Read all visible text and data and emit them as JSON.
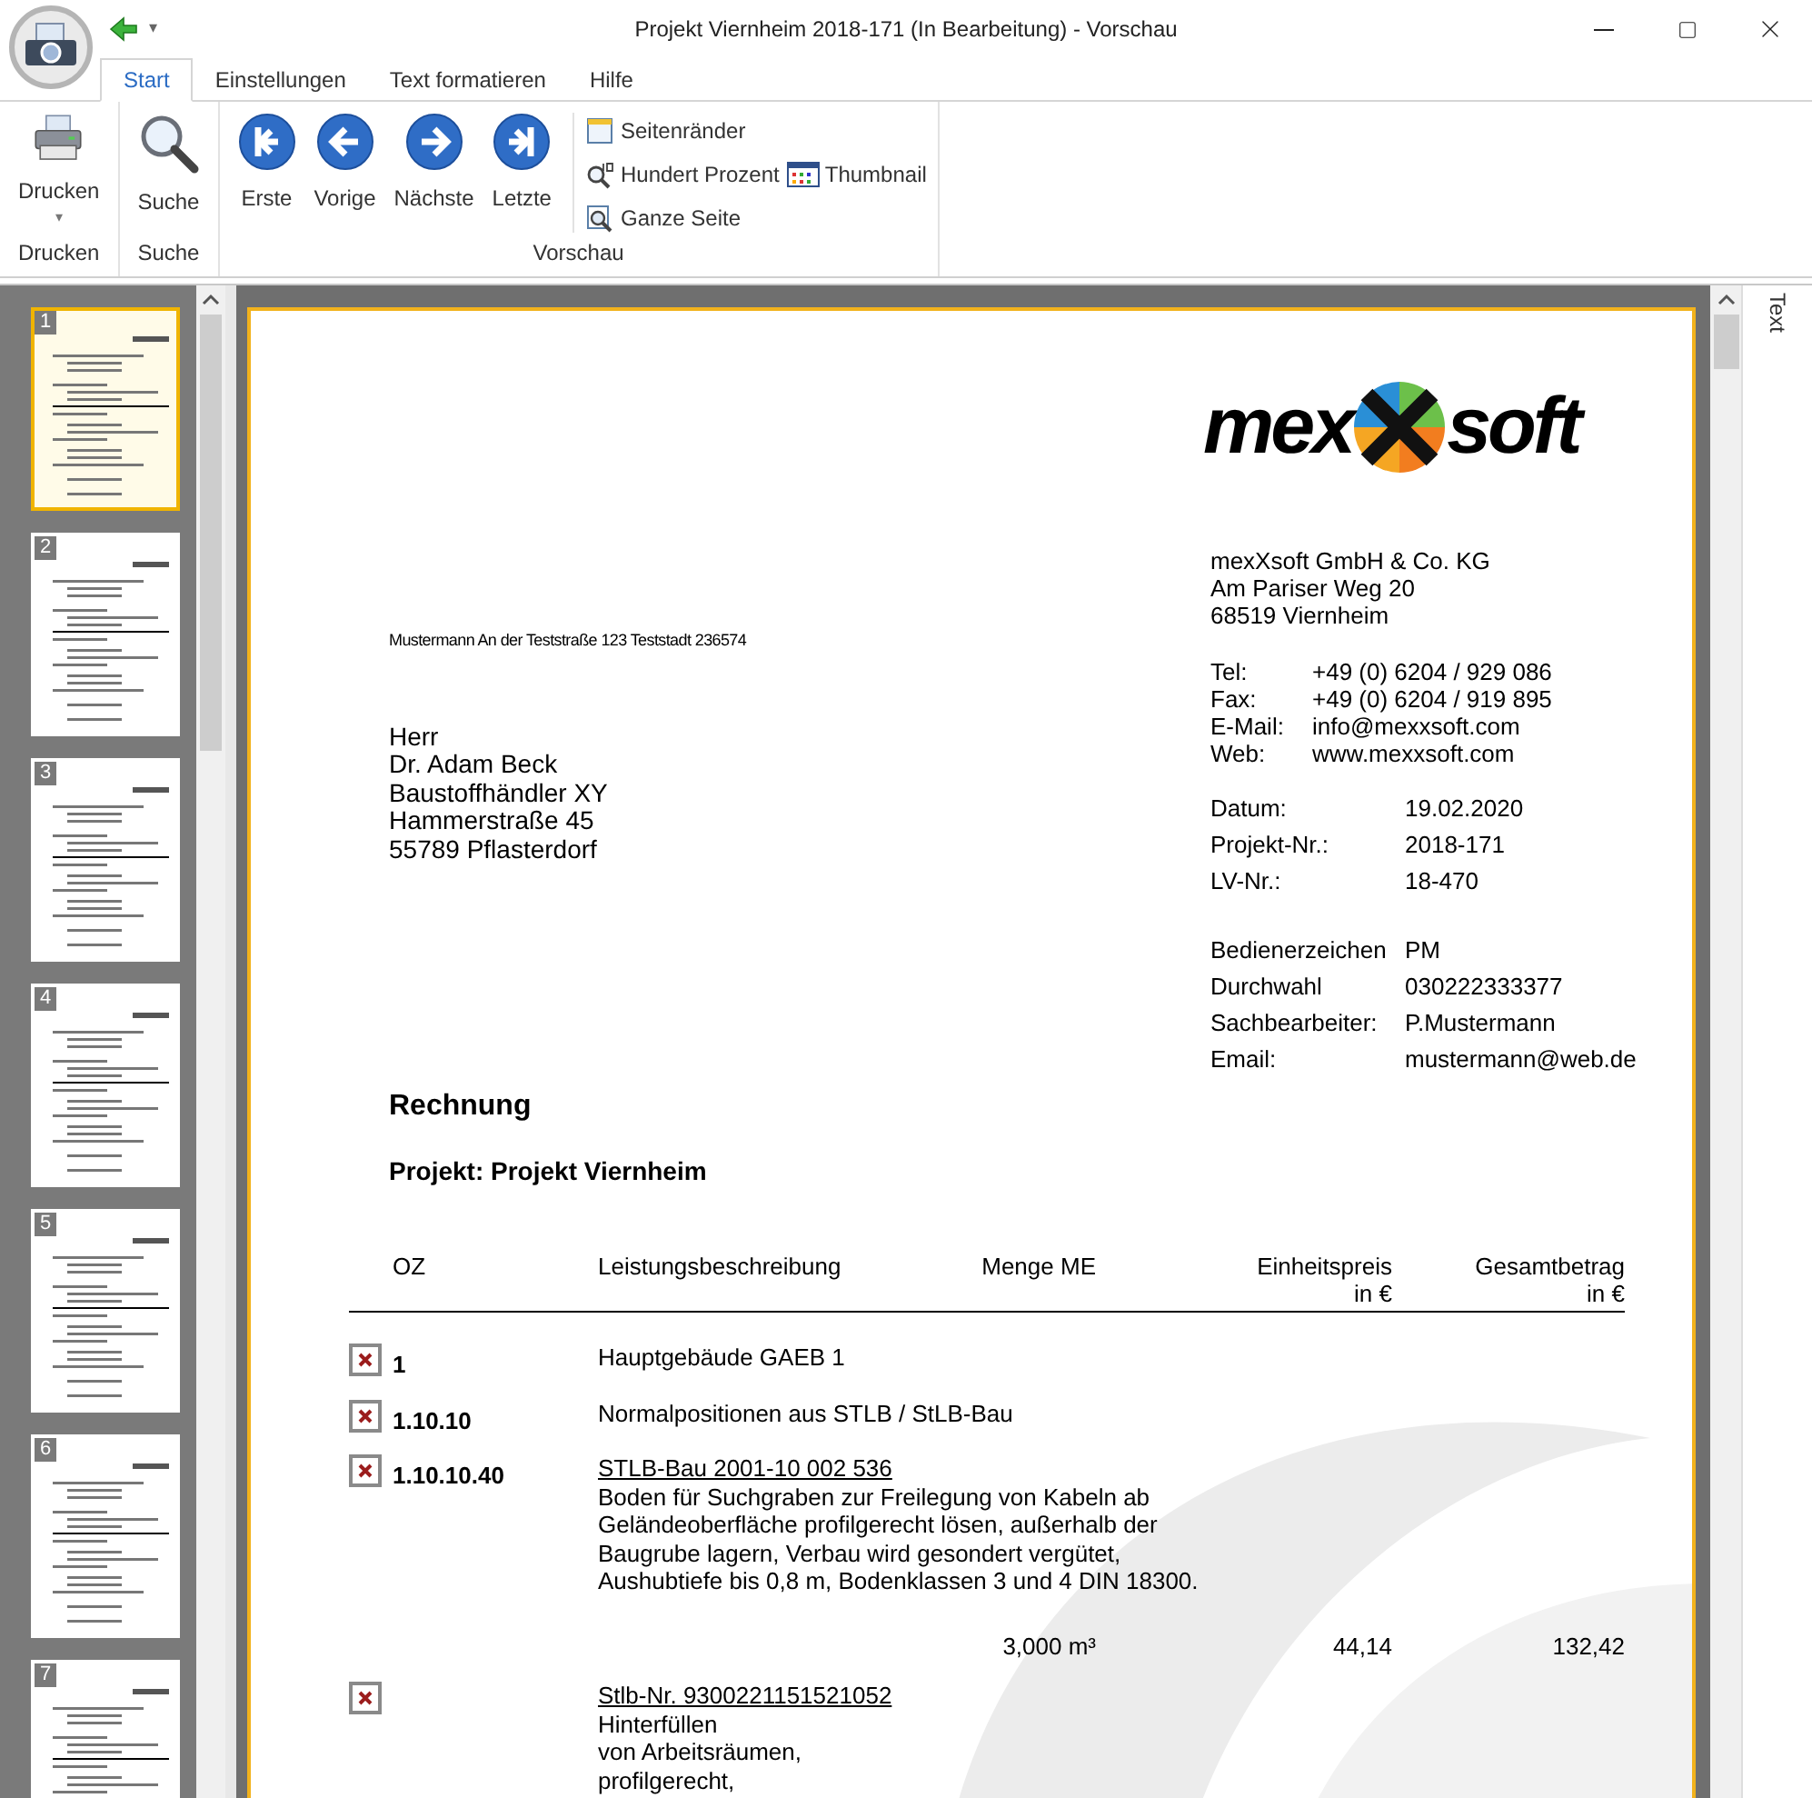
{
  "window": {
    "title": "Projekt Viernheim 2018-171 (In Bearbeitung) - Vorschau",
    "quick_access_caret": "▾"
  },
  "tabs": [
    {
      "label": "Start",
      "selected": true
    },
    {
      "label": "Einstellungen",
      "selected": false
    },
    {
      "label": "Text formatieren",
      "selected": false
    },
    {
      "label": "Hilfe",
      "selected": false
    }
  ],
  "ribbon": {
    "groups": [
      {
        "label": "Drucken",
        "buttons": [
          {
            "kind": "print",
            "label": "Drucken",
            "caret": "▾"
          }
        ]
      },
      {
        "label": "Suche",
        "buttons": [
          {
            "kind": "search",
            "label": "Suche"
          }
        ]
      },
      {
        "label": "Vorschau",
        "buttons": [
          {
            "kind": "first",
            "label": "Erste"
          },
          {
            "kind": "prev",
            "label": "Vorige"
          },
          {
            "kind": "next",
            "label": "Nächste"
          },
          {
            "kind": "last",
            "label": "Letzte"
          }
        ],
        "small_buttons": [
          {
            "kind": "margins",
            "label": "Seitenränder"
          },
          {
            "kind": "zoom100",
            "label": "Hundert Prozent"
          },
          {
            "kind": "thumbnail",
            "label": "Thumbnail"
          },
          {
            "kind": "wholepage",
            "label": "Ganze Seite"
          }
        ]
      }
    ]
  },
  "thumbnails": [
    {
      "label": "1",
      "selected": true
    },
    {
      "label": "2",
      "selected": false
    },
    {
      "label": "3",
      "selected": false
    },
    {
      "label": "4",
      "selected": false
    },
    {
      "label": "5",
      "selected": false
    },
    {
      "label": "6",
      "selected": false
    },
    {
      "label": "7",
      "selected": false
    }
  ],
  "side_panel": {
    "label": "Text"
  },
  "document": {
    "logo": {
      "left": "mex",
      "right": "soft"
    },
    "sender_line": "Mustermann An der Teststraße 123  Teststadt 236574",
    "recipient": [
      "Herr",
      "Dr. Adam Beck",
      "Baustoffhändler XY",
      "Hammerstraße 45",
      "55789 Pflasterdorf"
    ],
    "company": [
      "mexXsoft GmbH & Co. KG",
      "Am Pariser Weg 20",
      "68519 Viernheim"
    ],
    "contact": [
      {
        "label": "Tel:",
        "value": "+49 (0) 6204 / 929 086"
      },
      {
        "label": "Fax:",
        "value": "+49 (0) 6204 / 919 895"
      },
      {
        "label": "E-Mail:",
        "value": "info@mexxsoft.com"
      },
      {
        "label": "Web:",
        "value": "www.mexxsoft.com"
      }
    ],
    "meta": [
      {
        "label": "Datum:",
        "value": "19.02.2020"
      },
      {
        "label": "Projekt-Nr.:",
        "value": "2018-171"
      },
      {
        "label": "LV-Nr.:",
        "value": "18-470"
      }
    ],
    "staff": [
      {
        "label": "Bedienerzeichen",
        "value": "PM"
      },
      {
        "label": "Durchwahl",
        "value": "030222333377"
      },
      {
        "label": "Sachbearbeiter:",
        "value": "P.Mustermann"
      },
      {
        "label": "Email:",
        "value": "mustermann@web.de"
      }
    ],
    "heading": "Rechnung",
    "project": "Projekt: Projekt Viernheim",
    "columns": [
      {
        "lines": [
          "OZ"
        ]
      },
      {
        "lines": [
          "Leistungsbeschreibung"
        ]
      },
      {
        "lines": [
          "Menge ME"
        ]
      },
      {
        "lines": [
          "Einheitspreis",
          "in €"
        ]
      },
      {
        "lines": [
          "Gesamtbetrag",
          "in €"
        ]
      }
    ],
    "rows": [
      {
        "oz": "1",
        "title": "Hauptgebäude GAEB 1",
        "underlined": false
      },
      {
        "oz": "1.10.10",
        "title": "Normalpositionen aus STLB / StLB-Bau",
        "underlined": false
      },
      {
        "oz": "1.10.10.40",
        "title": "STLB-Bau 2001-10 002 536",
        "underlined": true,
        "description": [
          "Boden für Suchgraben zur Freilegung von Kabeln ab",
          "Geländeoberfläche profilgerecht lösen, außerhalb der",
          "Baugrube lagern, Verbau wird gesondert vergütet,",
          "Aushubtiefe bis 0,8 m, Bodenklassen 3 und 4 DIN 18300."
        ],
        "quantity": "3,000 m³",
        "unit_price": "44,14",
        "total": "132,42"
      },
      {
        "title": "Stlb-Nr. 9300221151521052",
        "underlined": true,
        "description": [
          "Hinterfüllen",
          "von Arbeitsräumen,",
          "profilgerecht,"
        ]
      }
    ]
  }
}
